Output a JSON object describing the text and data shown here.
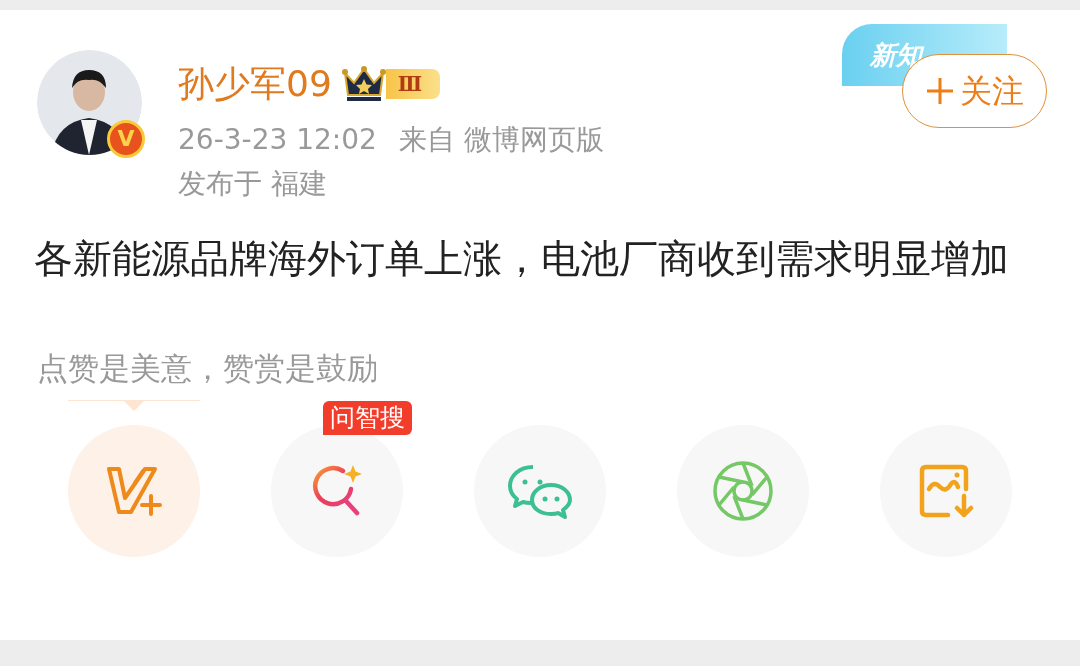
{
  "user": {
    "name": "孙少军09",
    "verified_mark": "V",
    "level_badge": "Ⅲ"
  },
  "meta": {
    "time": "26-3-23 12:02",
    "source": "来自 微博网页版",
    "location": "发布于 福建"
  },
  "banner": {
    "text": "新知"
  },
  "follow_button": {
    "label": "关注"
  },
  "post": {
    "text": "各新能源品牌海外订单上涨，电池厂商收到需求明显增加"
  },
  "reward_hint": "点赞是美意，赞赏是鼓励",
  "share_actions": [
    {
      "kind": "vip",
      "selected": true
    },
    {
      "kind": "search",
      "badge": "问智搜",
      "selected": false
    },
    {
      "kind": "wechat",
      "selected": false
    },
    {
      "kind": "moments",
      "selected": false
    },
    {
      "kind": "save-image",
      "selected": false
    }
  ]
}
